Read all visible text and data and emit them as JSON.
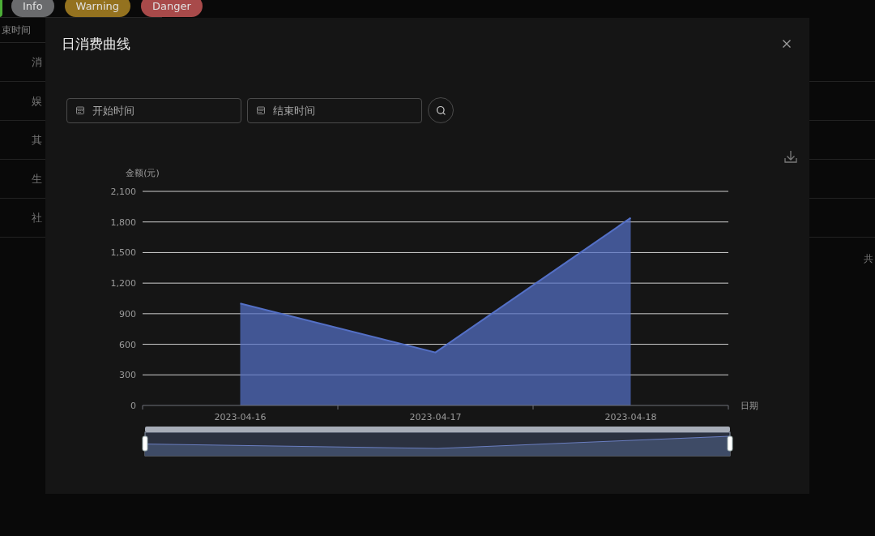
{
  "background_page": {
    "tags": [
      {
        "label": "Info",
        "color": "#6a6b6d"
      },
      {
        "label": "Warning",
        "color": "#94721f"
      },
      {
        "label": "Danger",
        "color": "#a84a4a"
      }
    ],
    "date_field": {
      "placeholder": "束时间"
    },
    "table_rows": [
      {
        "cell": "消"
      },
      {
        "cell": "娱"
      },
      {
        "cell": "其"
      },
      {
        "cell": "生"
      },
      {
        "cell": "社"
      }
    ],
    "pagination_text": "共"
  },
  "dialog": {
    "title": "日消费曲线",
    "filters": [
      {
        "placeholder": "开始时间"
      },
      {
        "placeholder": "结束时间"
      }
    ],
    "chart_data": {
      "type": "area",
      "grid": true,
      "xlabel": "日期",
      "ylabel": "金额(元)",
      "categories": [
        "2023-04-16",
        "2023-04-17",
        "2023-04-18"
      ],
      "ylim": [
        0,
        2100
      ],
      "yticks": [
        0,
        300,
        600,
        900,
        {
          "value": 1200,
          "label": "1,200"
        },
        {
          "value": 1500,
          "label": "1,500"
        },
        {
          "value": 1800,
          "label": "1,800"
        },
        {
          "value": 2100,
          "label": "2,100"
        }
      ],
      "series": [
        {
          "color": "#5470c6",
          "values": [
            1000,
            520,
            1840
          ]
        }
      ]
    }
  }
}
